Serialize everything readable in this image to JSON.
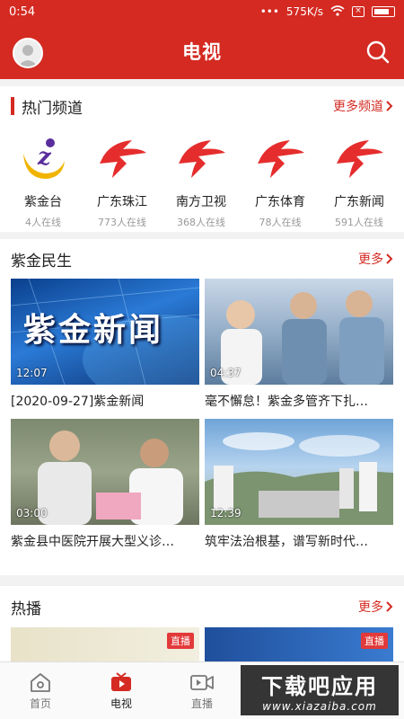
{
  "status_bar": {
    "time": "0:54",
    "dots": "•••",
    "speed": "575K/s"
  },
  "header": {
    "title": "电视"
  },
  "hot_channels": {
    "title": "热门频道",
    "more": "更多频道",
    "items": [
      {
        "name": "紫金台",
        "count": "4人在线"
      },
      {
        "name": "广东珠江",
        "count": "773人在线"
      },
      {
        "name": "南方卫视",
        "count": "368人在线"
      },
      {
        "name": "广东体育",
        "count": "78人在线"
      },
      {
        "name": "广东新闻",
        "count": "591人在线"
      }
    ]
  },
  "zijin_minsheng": {
    "title": "紫金民生",
    "more": "更多",
    "videos": [
      {
        "title": "[2020-09-27]紫金新闻",
        "duration": "12:07",
        "thumb_text": "紫金新闻"
      },
      {
        "title": "毫不懈怠！紫金多管齐下扎…",
        "duration": "04:37"
      },
      {
        "title": "紫金县中医院开展大型义诊…",
        "duration": "03:00"
      },
      {
        "title": "筑牢法治根基，谱写新时代…",
        "duration": "12:39"
      }
    ]
  },
  "hot_broadcast": {
    "title": "热播",
    "more": "更多",
    "items": [
      {
        "badge": "直播"
      },
      {
        "badge": "直播"
      }
    ]
  },
  "tabbar": {
    "tabs": [
      {
        "label": "首页"
      },
      {
        "label": "电视"
      },
      {
        "label": "直播"
      }
    ]
  },
  "watermark": {
    "line1": "下载吧应用",
    "line2": "www.xiazaiba.com"
  },
  "colors": {
    "brand_red": "#d42a22",
    "text": "#222222",
    "muted": "#999999"
  }
}
